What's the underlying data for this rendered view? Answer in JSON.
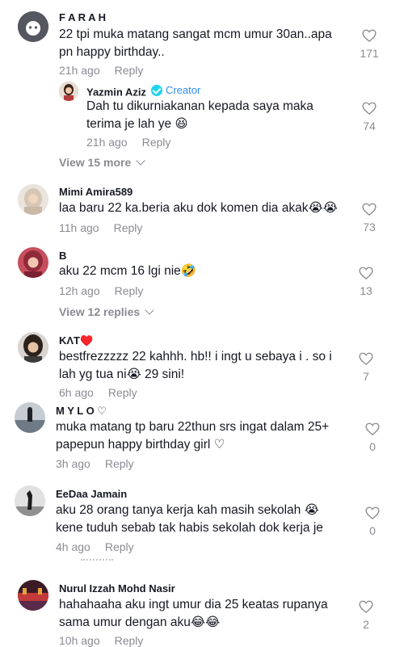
{
  "comments": [
    {
      "name": "F A R A H",
      "text": "22 tpi muka matang sangat mcm umur 30an..apa\npn happy birthday..",
      "time": "21h ago",
      "reply": "Reply",
      "likes": "171"
    },
    {
      "name": "Yazmin Aziz",
      "badge": "Creator",
      "text": "Dah tu dikurniakanan kepada saya maka\nterima je lah ye 😆",
      "time": "21h ago",
      "reply": "Reply",
      "likes": "74"
    },
    {
      "name": "Mimi Amira589",
      "text": "laa baru 22 ka.beria aku dok komen dia akak😭😭",
      "time": "11h ago",
      "reply": "Reply",
      "likes": "73"
    },
    {
      "name": "B",
      "text": "aku 22 mcm 16 lgi nie🤣",
      "time": "12h ago",
      "reply": "Reply",
      "likes": "13"
    },
    {
      "name": "KΛT♥️",
      "text": "bestfrezzzzz 22 kahhh. hb!! i ingt u sebaya i . so i\nlah yg tua ni😭 29 sini!",
      "time": "6h ago",
      "reply": "Reply",
      "likes": "7"
    },
    {
      "name": "M Y L O ♡",
      "text": "muka matang tp baru 22thun srs ingat dalam 25+\npapepun happy birthday girl ♡",
      "time": "3h ago",
      "reply": "Reply",
      "likes": "0"
    },
    {
      "name": "EeDaa Jamain",
      "text": "aku 28 orang tanya kerja kah masih sekolah 😭\nkene tuduh sebab tak habis sekolah dok kerja je",
      "time": "4h ago",
      "reply": "Reply",
      "likes": "0"
    },
    {
      "name": "Nurul Izzah Mohd Nasir",
      "text": "hahahaaha aku ingt umur dia 25 keatas rupanya\nsama umur dengan aku😂😂",
      "time": "10h ago",
      "reply": "Reply",
      "likes": "2"
    }
  ],
  "view_more": [
    {
      "label": "View 15 more"
    },
    {
      "label": "View 12 replies"
    }
  ],
  "icons": {
    "like": "heart-outline-icon",
    "expand": "chevron-down-icon",
    "verified": "verified-check-icon"
  }
}
